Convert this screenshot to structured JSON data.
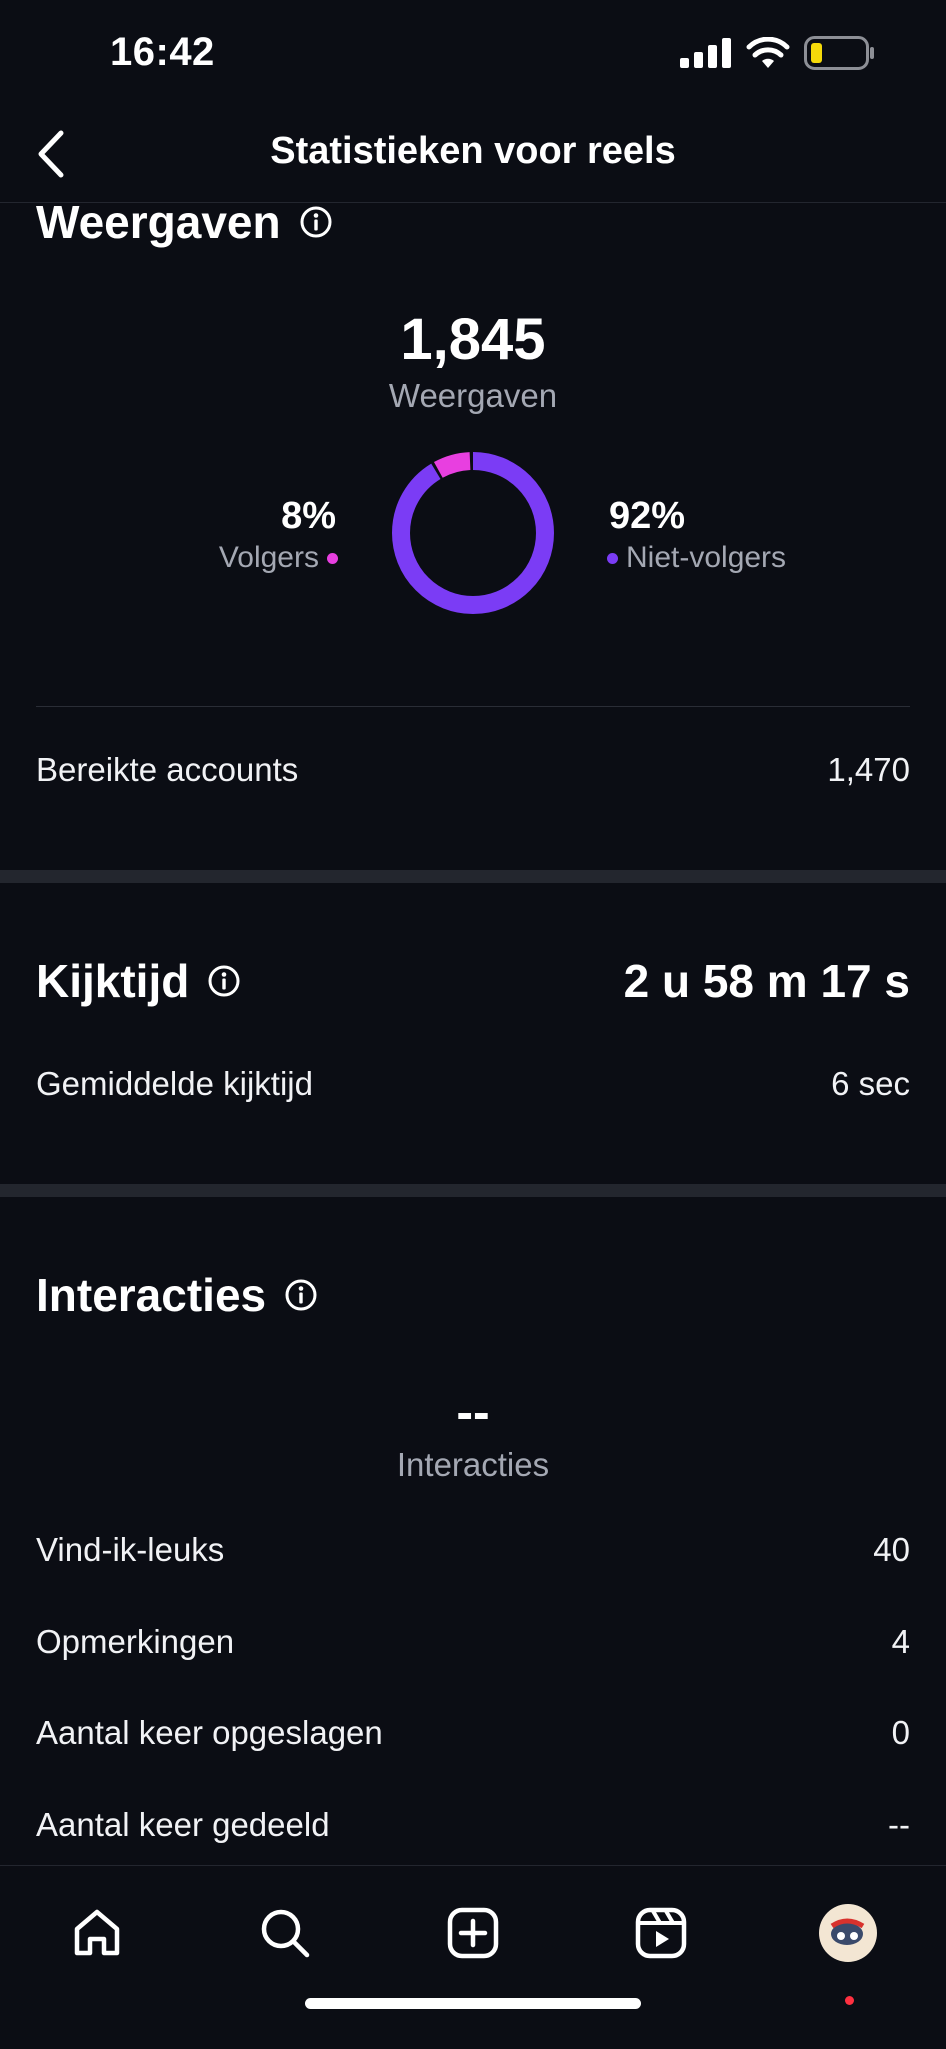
{
  "status": {
    "time": "16:42"
  },
  "header": {
    "title": "Statistieken voor reels"
  },
  "views": {
    "title": "Weergaven",
    "total": "1,845",
    "total_label": "Weergaven",
    "followers_pct": "8%",
    "followers_label": "Volgers",
    "non_followers_pct": "92%",
    "non_followers_label": "Niet-volgers",
    "followers_fraction": 0.08,
    "reached_label": "Bereikte accounts",
    "reached_value": "1,470"
  },
  "watch_time": {
    "title": "Kijktijd",
    "value": "2 u 58 m 17 s",
    "avg_label": "Gemiddelde kijktijd",
    "avg_value": "6 sec"
  },
  "interactions": {
    "title": "Interacties",
    "total": "--",
    "total_label": "Interacties",
    "rows": [
      {
        "label": "Vind-ik-leuks",
        "value": "40"
      },
      {
        "label": "Opmerkingen",
        "value": "4"
      },
      {
        "label": "Aantal keer opgeslagen",
        "value": "0"
      },
      {
        "label": "Aantal keer gedeeld",
        "value": "--"
      }
    ]
  },
  "tabbar": {
    "icons": [
      "home-icon",
      "search-icon",
      "create-icon",
      "reels-icon",
      "profile-avatar"
    ]
  },
  "colors": {
    "background": "#0b0d14",
    "followers": "#e83fe0",
    "non_followers": "#7b3cf5"
  }
}
